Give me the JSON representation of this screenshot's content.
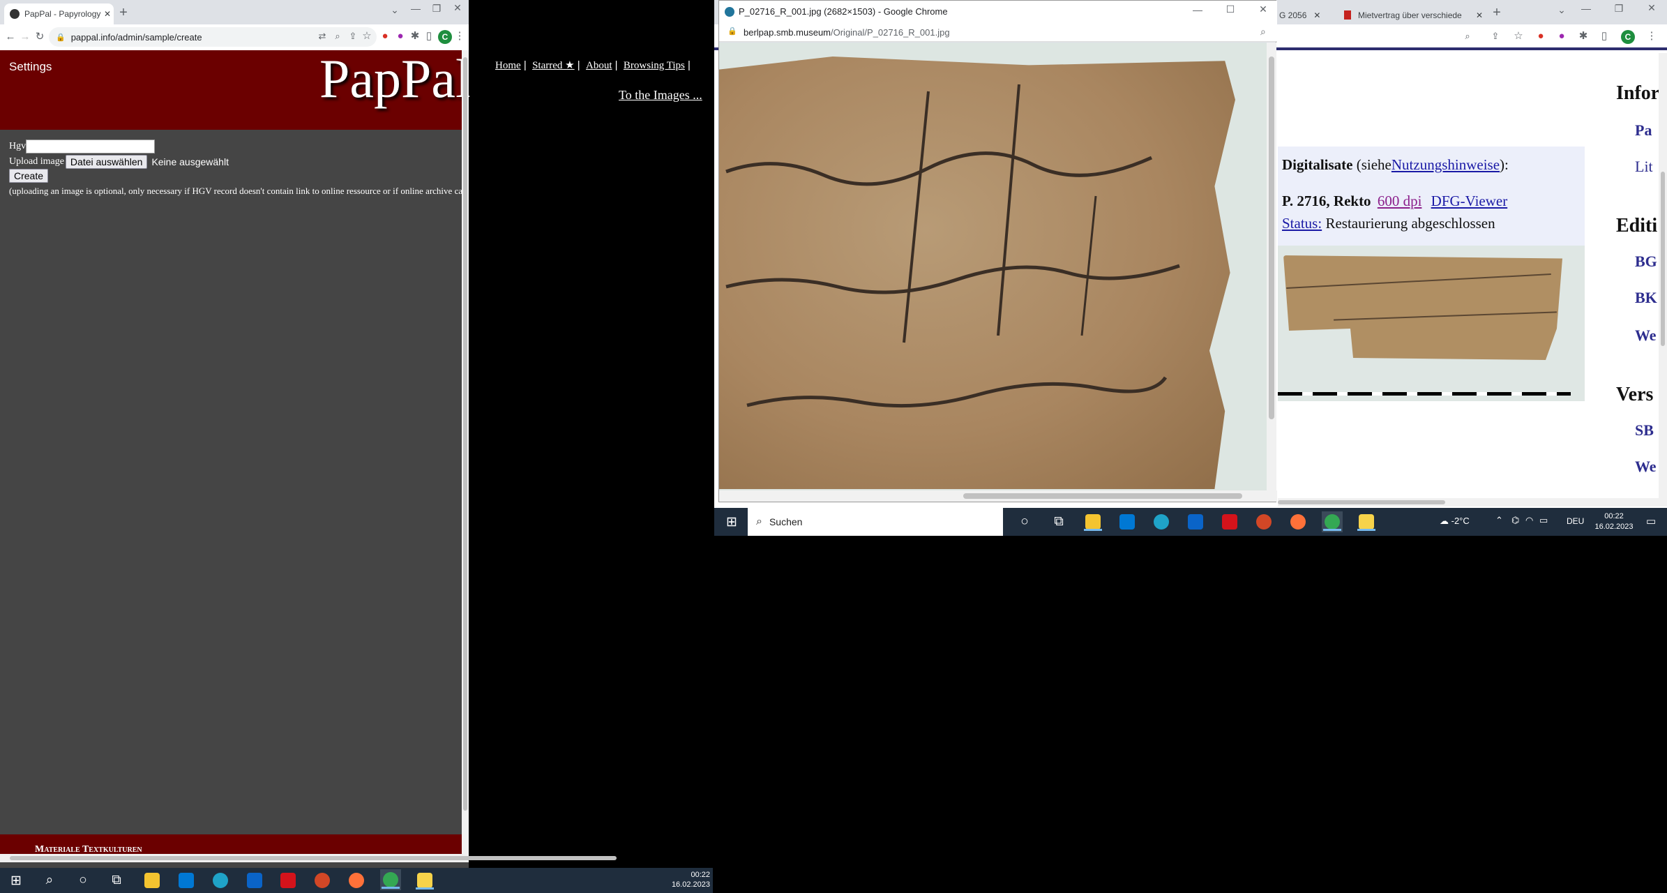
{
  "left_window": {
    "tab_title": "PapPal - Papyrology | Paleograph",
    "url": "pappal.info/admin/sample/create",
    "avatar_letter": "C",
    "page": {
      "settings": "Settings",
      "logo": "PapPal",
      "nav": [
        "Home",
        "Starred ★",
        "About",
        "Browsing Tips"
      ],
      "to_images": "To the Images ...",
      "hgv_label": "Hgv",
      "upload_label": "Upload image",
      "file_button": "Datei auswählen",
      "file_status": "Keine ausgewählt",
      "create_button": "Create",
      "note": "(uploading an image is optional, only necessary if HGV record doesn't contain link to online ressource or if online archive cannot be harvested, as is the case for",
      "footer": "Materiale Textkulturen"
    },
    "taskbar": {
      "time": "00:22",
      "date": "16.02.2023"
    }
  },
  "popup_window": {
    "title": "P_02716_R_001.jpg (2682×1503) - Google Chrome",
    "url_domain": "berlpap.smb.museum",
    "url_path": "/Original/P_02716_R_001.jpg"
  },
  "right_window": {
    "tabs": [
      "G 2056",
      "Mietvertrag über verschiede"
    ],
    "avatar_letter": "C",
    "digitalisate_label": "Digitalisate",
    "digitalisate_paren_open": "(siehe",
    "nutzungshinweise": "Nutzungshinweise",
    "digitalisate_paren_close": "):",
    "rekto": "P. 2716, Rekto",
    "dpi_link": "600 dpi",
    "dfg_link": "DFG-Viewer",
    "status_label": "Status:",
    "status_value": "Restaurierung abgeschlossen",
    "side_headings": [
      "Infor",
      "Editi",
      "Vers"
    ],
    "side_links": [
      "Pa",
      "Lit",
      "BG",
      "BK",
      "We",
      "SB",
      "We"
    ]
  },
  "taskbar2": {
    "search_placeholder": "Suchen",
    "weather": "-2°C",
    "lang": "DEU",
    "time": "00:22",
    "date": "16.02.2023"
  },
  "colors": {
    "pappal_red": "#6b0000",
    "page_gray": "#454545",
    "taskbar": "#1f2d3d",
    "link_blue": "#1a1aa6"
  }
}
